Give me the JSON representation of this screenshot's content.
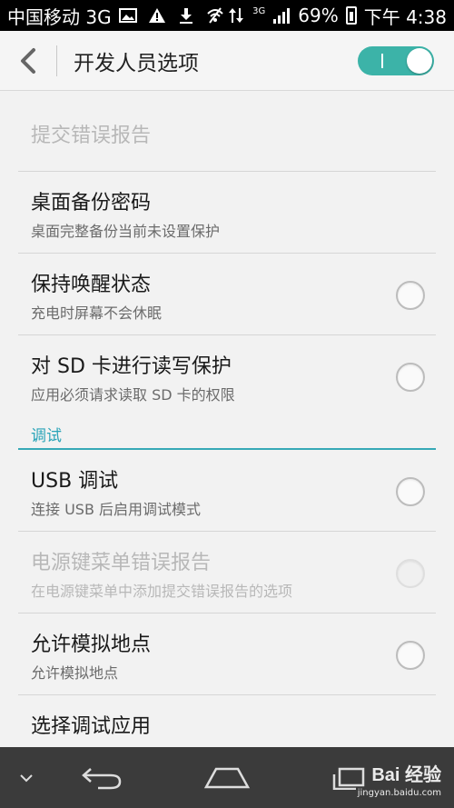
{
  "status_bar": {
    "carrier": "中国移动 3G",
    "network_label": "3G",
    "battery": "69%",
    "time": "下午 4:38"
  },
  "header": {
    "title": "开发人员选项",
    "master_toggle_on": true
  },
  "rows": [
    {
      "title": "提交错误报告",
      "subtitle": "",
      "disabled": true,
      "has_radio": false
    },
    {
      "title": "桌面备份密码",
      "subtitle": "桌面完整备份当前未设置保护",
      "disabled": false,
      "has_radio": false
    },
    {
      "title": "保持唤醒状态",
      "subtitle": "充电时屏幕不会休眠",
      "disabled": false,
      "has_radio": true,
      "checked": false
    },
    {
      "title": "对 SD 卡进行读写保护",
      "subtitle": "应用必须请求读取 SD 卡的权限",
      "disabled": false,
      "has_radio": true,
      "checked": false
    }
  ],
  "section_debug": {
    "label": "调试"
  },
  "debug_rows": [
    {
      "title": "USB 调试",
      "subtitle": "连接 USB 后启用调试模式",
      "disabled": false,
      "has_radio": true,
      "checked": false
    },
    {
      "title": "电源键菜单错误报告",
      "subtitle": "在电源键菜单中添加提交错误报告的选项",
      "disabled": true,
      "has_radio": true,
      "checked": false
    },
    {
      "title": "允许模拟地点",
      "subtitle": "允许模拟地点",
      "disabled": false,
      "has_radio": true,
      "checked": false
    },
    {
      "title": "选择调试应用",
      "subtitle": "",
      "disabled": false,
      "has_radio": false
    }
  ],
  "watermark": {
    "brand": "Bai 经验",
    "url": "jingyan.baidu.com"
  },
  "colors": {
    "accent": "#37a9b7",
    "toggle_on": "#3cb3a8",
    "nav_bar": "#3b3b3b"
  }
}
